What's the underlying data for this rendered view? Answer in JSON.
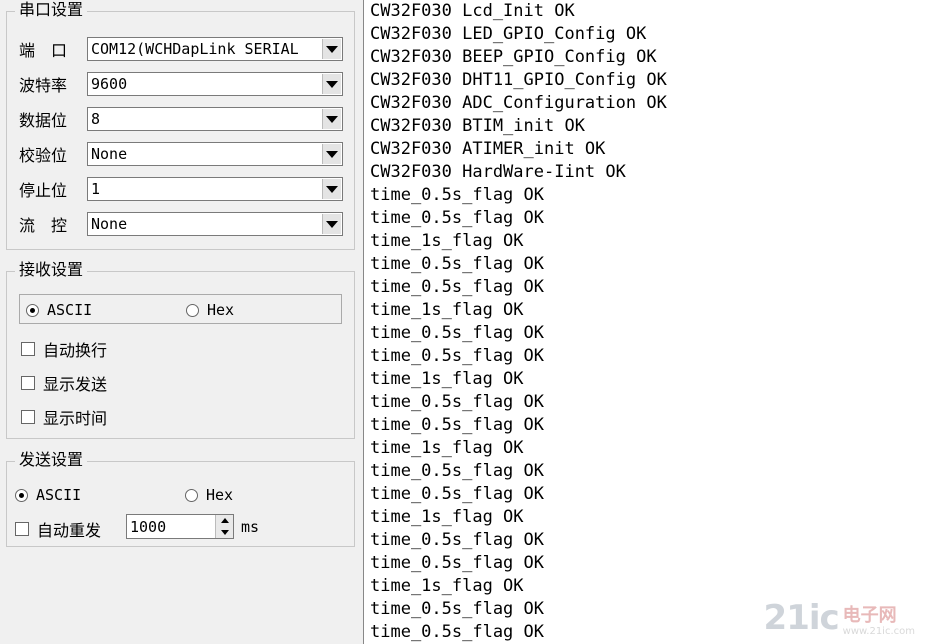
{
  "serial_group": {
    "title": "串口设置",
    "rows": [
      {
        "label": "端　口",
        "value": "COM12(WCHDapLink SERIAL"
      },
      {
        "label": "波特率",
        "value": "9600"
      },
      {
        "label": "数据位",
        "value": "8"
      },
      {
        "label": "校验位",
        "value": "None"
      },
      {
        "label": "停止位",
        "value": "1"
      },
      {
        "label": "流　控",
        "value": "None"
      }
    ]
  },
  "receive_group": {
    "title": "接收设置",
    "ascii_label": "ASCII",
    "hex_label": "Hex",
    "selected": "ASCII",
    "checkboxes": [
      {
        "label": "自动换行",
        "checked": false
      },
      {
        "label": "显示发送",
        "checked": false
      },
      {
        "label": "显示时间",
        "checked": false
      }
    ]
  },
  "send_group": {
    "title": "发送设置",
    "ascii_label": "ASCII",
    "hex_label": "Hex",
    "selected": "ASCII",
    "auto_resend_label": "自动重发",
    "interval_value": "1000",
    "interval_unit": "ms"
  },
  "output_lines": [
    "CW32F030 Lcd_Init OK",
    "CW32F030 LED_GPIO_Config OK",
    "CW32F030 BEEP_GPIO_Config OK",
    "CW32F030 DHT11_GPIO_Config OK",
    "CW32F030 ADC_Configuration OK",
    "CW32F030 BTIM_init OK",
    "CW32F030 ATIMER_init OK",
    "CW32F030 HardWare-Iint OK",
    "time_0.5s_flag OK",
    "time_0.5s_flag OK",
    "time_1s_flag OK",
    "time_0.5s_flag OK",
    "time_0.5s_flag OK",
    "time_1s_flag OK",
    "time_0.5s_flag OK",
    "time_0.5s_flag OK",
    "time_1s_flag OK",
    "time_0.5s_flag OK",
    "time_0.5s_flag OK",
    "time_1s_flag OK",
    "time_0.5s_flag OK",
    "time_0.5s_flag OK",
    "time_1s_flag OK",
    "time_0.5s_flag OK",
    "time_0.5s_flag OK",
    "time_1s_flag OK",
    "time_0.5s_flag OK",
    "time_0.5s_flag OK"
  ],
  "watermark": {
    "logo": "21ic",
    "cn": "电子网",
    "url": "www.21ic.com"
  }
}
